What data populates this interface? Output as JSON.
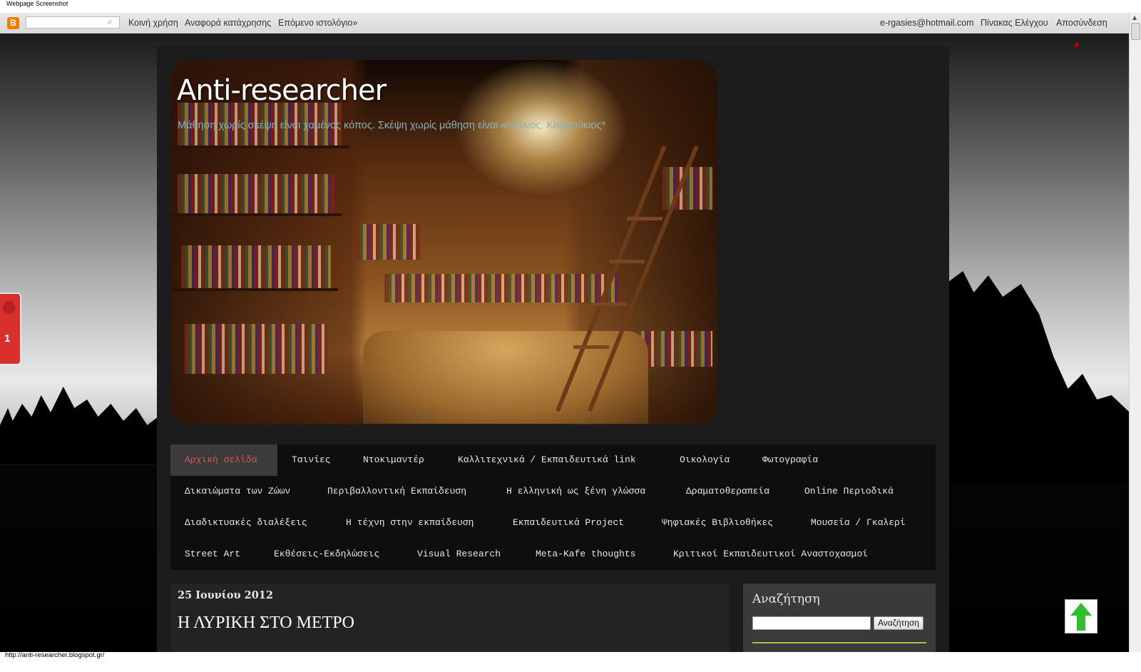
{
  "window": {
    "caption": "Webpage Screenshot"
  },
  "navbar": {
    "logo_letter": "B",
    "search_value": "",
    "links": [
      "Κοινή χρήση",
      "Αναφορά κατάχρησης",
      "Επόμενο ιστολόγιο»"
    ],
    "user_email": "e-rgasies@hotmail.com",
    "dashboard": "Πίνακας Ελέγχου",
    "signout": "Αποσύνδεση"
  },
  "header": {
    "title": "Anti-researcher",
    "description": "Μάθηση χωρίς σκέψη είναι χαμένος κόπος. Σκέψη χωρίς μάθηση είναι κίνδυνος. Κομφούκιος*"
  },
  "tabs": [
    "Αρχική σελίδα",
    "Ταινίες",
    "Ντοκιμαντέρ",
    "Καλλιτεχνικά / Εκπαιδευτικά link",
    "Οικολογία",
    "Φωτογραφία",
    "Δικαιώματα των Ζώων",
    "Περιβαλλοντική Εκπαίδευση",
    "Η ελληνική ως ξένη γλώσσα",
    "Δραματοθεραπεία",
    "Online Περιοδικά",
    "Διαδικτυακές διαλέξεις",
    "Η τέχνη στην εκπαίδευση",
    "Εκπαιδευτικά Project",
    "Ψηφιακές Βιβλιοθήκες",
    "Μουσεία / Γκαλερί",
    "Street Art",
    "Εκθέσεις-Εκδηλώσεις",
    "Visual Research",
    "Meta-Kafe thoughts",
    "Κριτικοί Εκπαιδευτικοί Αναστοχασμοί"
  ],
  "post": {
    "date": "25 Ιουνίου 2012",
    "title": "Η ΛΥΡΙΚΗ ΣΤΟ ΜΕΤΡΟ"
  },
  "sidebar": {
    "search_title": "Αναζήτηση",
    "search_value": "",
    "search_button": "Αναζήτηση"
  },
  "share_widget": {
    "count": "1"
  },
  "status": {
    "url": "http://anti-researcher.blogspot.gr/"
  },
  "colors": {
    "active_tab": "#d9534f",
    "tabs_bg": "#0f0d0d",
    "desc_text": "#8ab0ba",
    "blogger_orange": "#f57d00"
  }
}
